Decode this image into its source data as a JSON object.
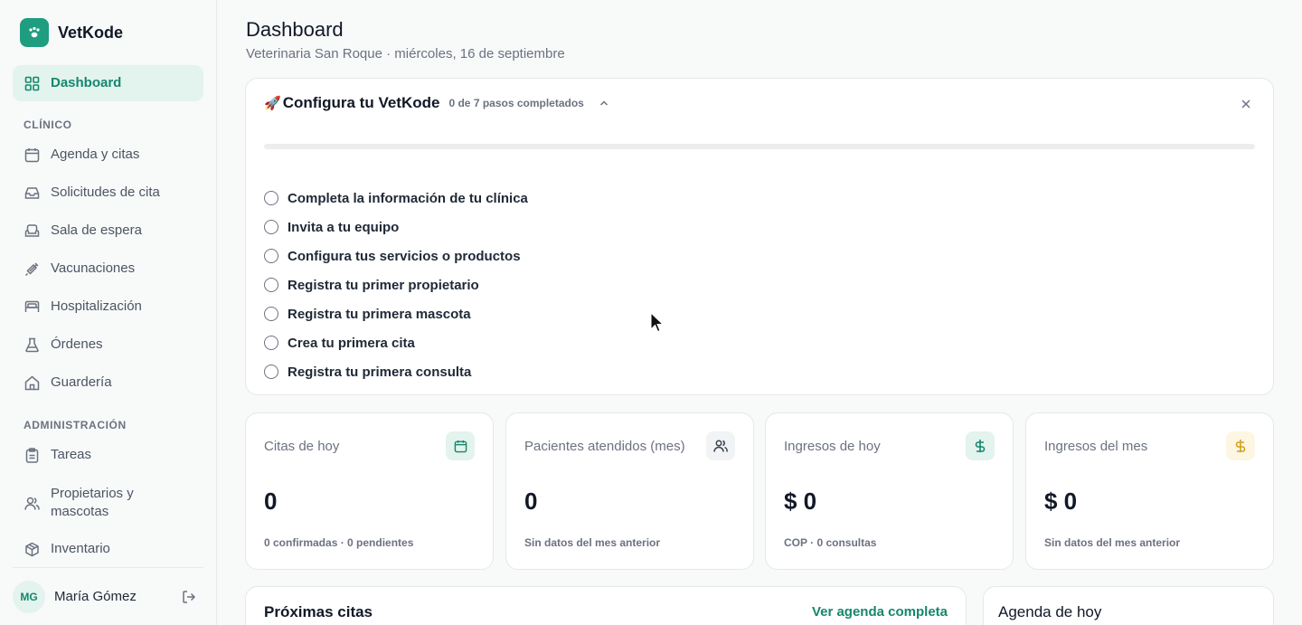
{
  "app": {
    "name": "VetKode",
    "logo_icon": "paw-icon",
    "accent": "#1f9d80"
  },
  "sidebar": {
    "dashboard": {
      "label": "Dashboard",
      "icon": "grid-icon"
    },
    "sections": {
      "clinico": "CLÍNICO",
      "administracion": "ADMINISTRACIÓN"
    },
    "clinico_items": [
      {
        "label": "Agenda y citas",
        "icon": "calendar-icon"
      },
      {
        "label": "Solicitudes de cita",
        "icon": "inbox-icon"
      },
      {
        "label": "Sala de espera",
        "icon": "armchair-icon"
      },
      {
        "label": "Vacunaciones",
        "icon": "syringe-icon"
      },
      {
        "label": "Hospitalización",
        "icon": "bed-icon"
      },
      {
        "label": "Órdenes",
        "icon": "flask-icon"
      },
      {
        "label": "Guardería",
        "icon": "house-icon"
      }
    ],
    "admin_items": [
      {
        "label": "Tareas",
        "icon": "clipboard-icon"
      },
      {
        "label": "Propietarios y",
        "label2": "mascotas",
        "icon": "users-icon"
      },
      {
        "label": "Inventario",
        "icon": "package-icon"
      }
    ],
    "user": {
      "initials": "MG",
      "name": "María Gómez",
      "logout_icon": "logout-icon"
    }
  },
  "header": {
    "title": "Dashboard",
    "subtitle": "Veterinaria San Roque · miércoles, 16 de septiembre"
  },
  "setup": {
    "emoji": "🚀",
    "title": "Configura tu VetKode",
    "progress_text": "0 de 7 pasos completados",
    "progress_fraction": 0,
    "steps": [
      "Completa la información de tu clínica",
      "Invita a tu equipo",
      "Configura tus servicios o productos",
      "Registra tu primer propietario",
      "Registra tu primera mascota",
      "Crea tu primera cita",
      "Registra tu primera consulta"
    ]
  },
  "stats": [
    {
      "label": "Citas de hoy",
      "value": "0",
      "foot": "0 confirmadas · 0 pendientes",
      "icon": "calendar-icon",
      "icon_bg": "#e3f3ee",
      "icon_color": "#15876d"
    },
    {
      "label": "Pacientes atendidos (mes)",
      "value": "0",
      "foot": "Sin datos del mes anterior",
      "icon": "users-icon",
      "icon_bg": "#f1f3f4",
      "icon_color": "#374151"
    },
    {
      "label": "Ingresos de hoy",
      "value": "$ 0",
      "foot": "COP · 0 consultas",
      "icon": "dollar-icon",
      "icon_bg": "#e3f3ee",
      "icon_color": "#15876d"
    },
    {
      "label": "Ingresos del mes",
      "value": "$ 0",
      "foot": "Sin datos del mes anterior",
      "icon": "dollar-icon",
      "icon_bg": "#fdf6e3",
      "icon_color": "#d4a017"
    }
  ],
  "proximas": {
    "title": "Próximas citas",
    "link": "Ver agenda completa"
  },
  "agenda_hoy": {
    "title": "Agenda de hoy"
  }
}
